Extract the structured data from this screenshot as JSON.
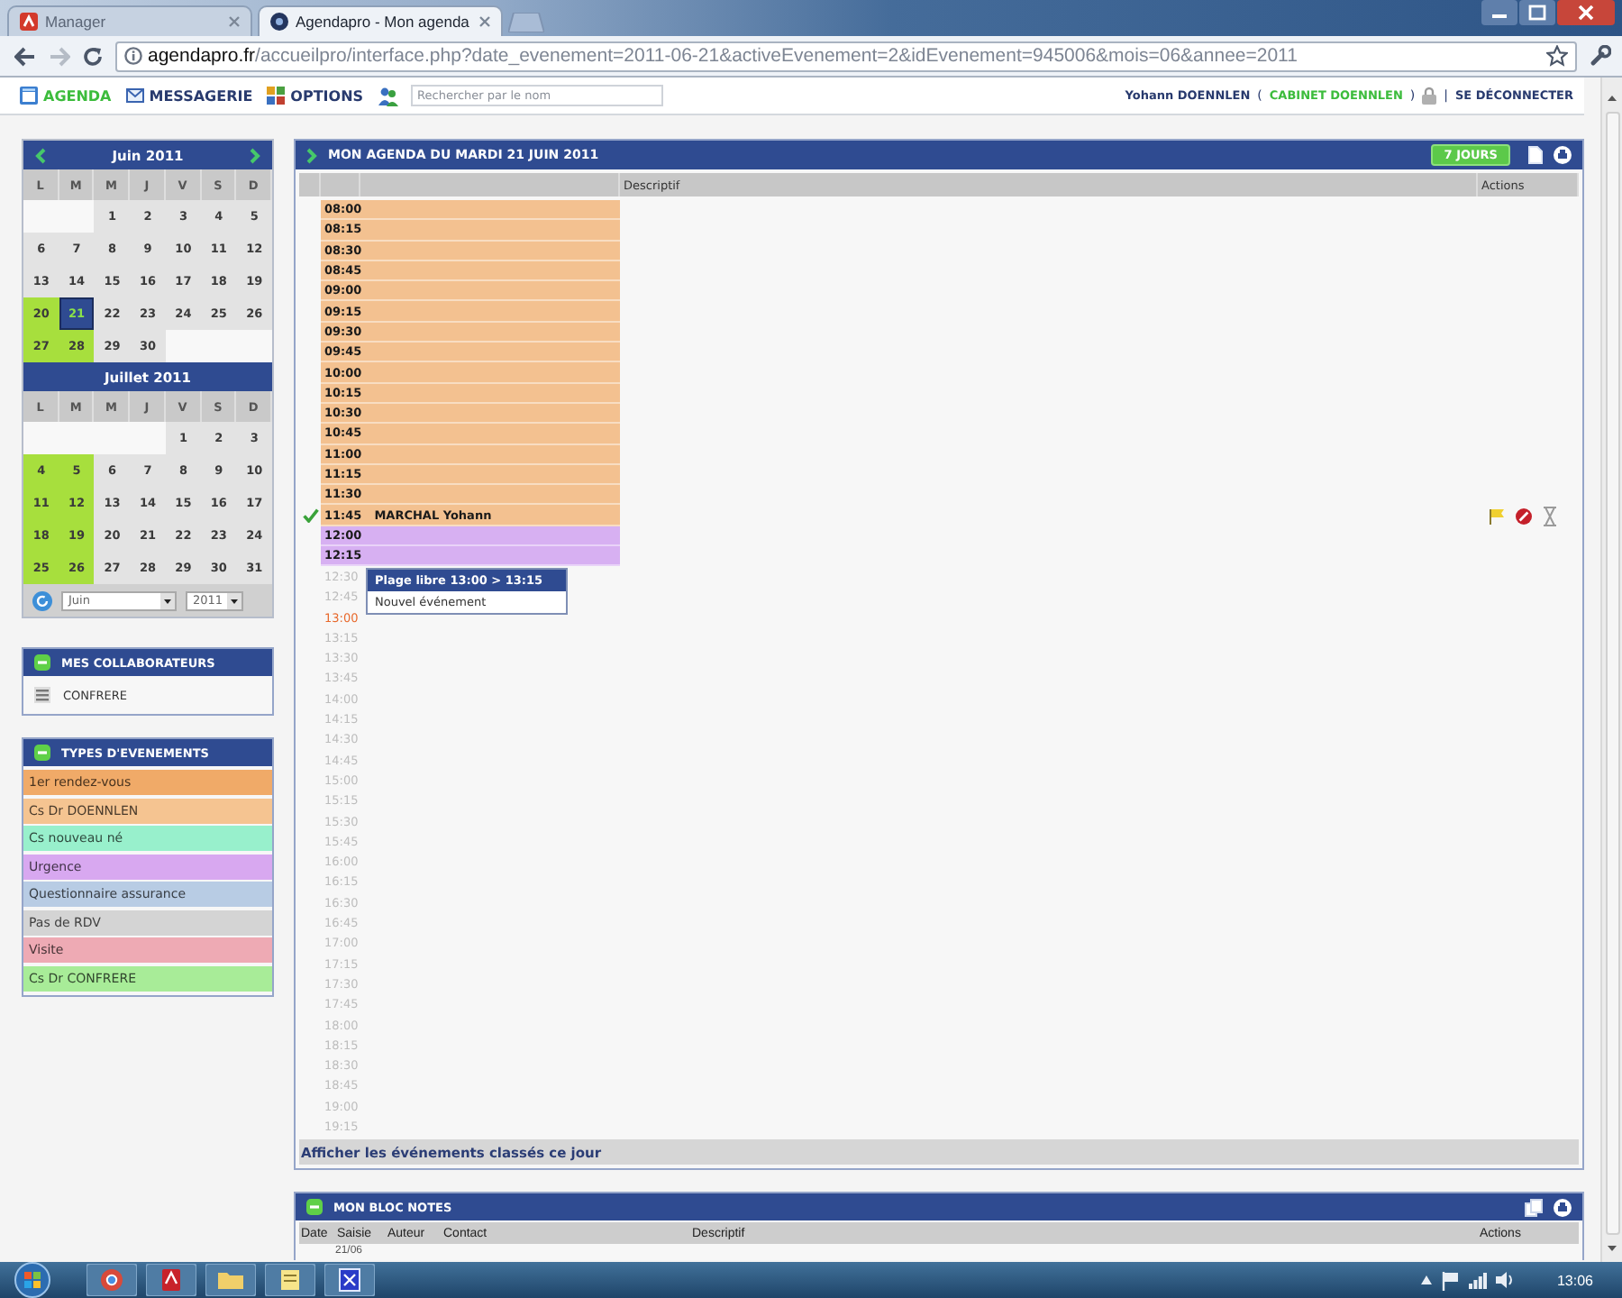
{
  "browser": {
    "tabs": [
      {
        "title": "Manager",
        "selected": false
      },
      {
        "title": "Agendapro - Mon agenda",
        "selected": true
      }
    ],
    "url_host": "agendapro.fr",
    "url_path": "/accueilpro/interface.php?date_evenement=2011-06-21&activeEvenement=2&idEvenement=945006&mois=06&annee=2011"
  },
  "nav": {
    "items": [
      {
        "label": "AGENDA",
        "selected": true
      },
      {
        "label": "MESSAGERIE",
        "selected": false
      },
      {
        "label": "OPTIONS",
        "selected": false
      }
    ],
    "search": {
      "placeholder": "Rechercher par le nom"
    },
    "user": "Yohann DOENNLEN",
    "cabinet_open": "(",
    "cabinet": "CABINET DOENNLEN",
    "cabinet_close": ")",
    "separator": "|",
    "logout": "SE DÉCONNECTER"
  },
  "calendar": {
    "months": [
      {
        "title": "Juin 2011",
        "nav_arrows": true,
        "weekdays": [
          "L",
          "M",
          "M",
          "J",
          "V",
          "S",
          "D"
        ],
        "weeks": [
          [
            {
              "d": "1",
              "has_events": false,
              "selected": false
            },
            {
              "d": "2",
              "has_events": false,
              "selected": false
            },
            {
              "d": "3",
              "has_events": false,
              "selected": false
            },
            {
              "d": "4",
              "has_events": false,
              "selected": false
            },
            {
              "d": "5",
              "has_events": false,
              "selected": false
            }
          ],
          [
            {
              "d": "6",
              "has_events": false,
              "selected": false
            },
            {
              "d": "7",
              "has_events": false,
              "selected": false
            },
            {
              "d": "8",
              "has_events": false,
              "selected": false
            },
            {
              "d": "9",
              "has_events": false,
              "selected": false
            },
            {
              "d": "10",
              "has_events": false,
              "selected": false
            },
            {
              "d": "11",
              "has_events": false,
              "selected": false
            },
            {
              "d": "12",
              "has_events": false,
              "selected": false
            }
          ],
          [
            {
              "d": "13",
              "has_events": false,
              "selected": false
            },
            {
              "d": "14",
              "has_events": false,
              "selected": false
            },
            {
              "d": "15",
              "has_events": false,
              "selected": false
            },
            {
              "d": "16",
              "has_events": false,
              "selected": false
            },
            {
              "d": "17",
              "has_events": false,
              "selected": false
            },
            {
              "d": "18",
              "has_events": false,
              "selected": false
            },
            {
              "d": "19",
              "has_events": false,
              "selected": false
            }
          ],
          [
            {
              "d": "20",
              "has_events": true,
              "selected": false
            },
            {
              "d": "21",
              "has_events": true,
              "selected": true
            },
            {
              "d": "22",
              "has_events": false,
              "selected": false
            },
            {
              "d": "23",
              "has_events": false,
              "selected": false
            },
            {
              "d": "24",
              "has_events": false,
              "selected": false
            },
            {
              "d": "25",
              "has_events": false,
              "selected": false
            },
            {
              "d": "26",
              "has_events": false,
              "selected": false
            }
          ],
          [
            {
              "d": "27",
              "has_events": true,
              "selected": false
            },
            {
              "d": "28",
              "has_events": true,
              "selected": false
            },
            {
              "d": "29",
              "has_events": false,
              "selected": false
            },
            {
              "d": "30",
              "has_events": false,
              "selected": false
            }
          ]
        ]
      },
      {
        "title": "Juillet 2011",
        "nav_arrows": false,
        "weekdays": [
          "L",
          "M",
          "M",
          "J",
          "V",
          "S",
          "D"
        ],
        "weeks": [
          [
            {
              "d": "1",
              "has_events": false,
              "selected": false
            },
            {
              "d": "2",
              "has_events": false,
              "selected": false
            },
            {
              "d": "3",
              "has_events": false,
              "selected": false
            }
          ],
          [
            {
              "d": "4",
              "has_events": true,
              "selected": false
            },
            {
              "d": "5",
              "has_events": true,
              "selected": false
            },
            {
              "d": "6",
              "has_events": false,
              "selected": false
            },
            {
              "d": "7",
              "has_events": false,
              "selected": false
            },
            {
              "d": "8",
              "has_events": false,
              "selected": false
            },
            {
              "d": "9",
              "has_events": false,
              "selected": false
            },
            {
              "d": "10",
              "has_events": false,
              "selected": false
            }
          ],
          [
            {
              "d": "11",
              "has_events": true,
              "selected": false
            },
            {
              "d": "12",
              "has_events": true,
              "selected": false
            },
            {
              "d": "13",
              "has_events": false,
              "selected": false
            },
            {
              "d": "14",
              "has_events": false,
              "selected": false
            },
            {
              "d": "15",
              "has_events": false,
              "selected": false
            },
            {
              "d": "16",
              "has_events": false,
              "selected": false
            },
            {
              "d": "17",
              "has_events": false,
              "selected": false
            }
          ],
          [
            {
              "d": "18",
              "has_events": true,
              "selected": false
            },
            {
              "d": "19",
              "has_events": true,
              "selected": false
            },
            {
              "d": "20",
              "has_events": false,
              "selected": false
            },
            {
              "d": "21",
              "has_events": false,
              "selected": false
            },
            {
              "d": "22",
              "has_events": false,
              "selected": false
            },
            {
              "d": "23",
              "has_events": false,
              "selected": false
            },
            {
              "d": "24",
              "has_events": false,
              "selected": false
            }
          ],
          [
            {
              "d": "25",
              "has_events": true,
              "selected": false
            },
            {
              "d": "26",
              "has_events": true,
              "selected": false
            },
            {
              "d": "27",
              "has_events": false,
              "selected": false
            },
            {
              "d": "28",
              "has_events": false,
              "selected": false
            },
            {
              "d": "29",
              "has_events": false,
              "selected": false
            },
            {
              "d": "30",
              "has_events": false,
              "selected": false
            },
            {
              "d": "31",
              "has_events": false,
              "selected": false
            }
          ]
        ]
      }
    ],
    "month_select": "Juin",
    "year_select": "2011"
  },
  "collaborators": {
    "title": "MES COLLABORATEURS",
    "items": [
      {
        "name": "CONFRERE"
      }
    ]
  },
  "event_types": {
    "title": "TYPES D'EVENEMENTS",
    "items": [
      {
        "label": "1er rendez-vous",
        "color": "#f0aa68"
      },
      {
        "label": "Cs Dr DOENNLEN",
        "color": "#f5c491"
      },
      {
        "label": "Cs nouveau né",
        "color": "#98f0cc"
      },
      {
        "label": "Urgence",
        "color": "#d8a8f0"
      },
      {
        "label": "Questionnaire assurance",
        "color": "#b8cce4"
      },
      {
        "label": "Pas de RDV",
        "color": "#d4d4d4"
      },
      {
        "label": "Visite",
        "color": "#eeaab4"
      },
      {
        "label": "Cs Dr CONFRERE",
        "color": "#a8ec98"
      }
    ]
  },
  "agenda": {
    "title": "MON AGENDA DU MARDI 21 JUIN 2011",
    "week_button": "7 JOURS",
    "columns": [
      "Descriptif",
      "Actions"
    ],
    "rows": [
      {
        "time": "08:00",
        "kind": "event",
        "color": "#f3c190"
      },
      {
        "time": "08:15",
        "kind": "event",
        "color": "#f3c190"
      },
      {
        "time": "08:30",
        "kind": "event",
        "color": "#f3c190"
      },
      {
        "time": "08:45",
        "kind": "event",
        "color": "#f3c190"
      },
      {
        "time": "09:00",
        "kind": "event",
        "color": "#f3c190"
      },
      {
        "time": "09:15",
        "kind": "event",
        "color": "#f3c190"
      },
      {
        "time": "09:30",
        "kind": "event",
        "color": "#f3c190"
      },
      {
        "time": "09:45",
        "kind": "event",
        "color": "#f3c190"
      },
      {
        "time": "10:00",
        "kind": "event",
        "color": "#f3c190"
      },
      {
        "time": "10:15",
        "kind": "event",
        "color": "#f3c190"
      },
      {
        "time": "10:30",
        "kind": "event",
        "color": "#f3c190"
      },
      {
        "time": "10:45",
        "kind": "event",
        "color": "#f3c190"
      },
      {
        "time": "11:00",
        "kind": "event",
        "color": "#f3c190"
      },
      {
        "time": "11:15",
        "kind": "event",
        "color": "#f3c190"
      },
      {
        "time": "11:30",
        "kind": "event",
        "color": "#f3c190"
      },
      {
        "time": "11:45",
        "kind": "appointment",
        "color": "#f3c190",
        "title": "MARCHAL Yohann",
        "confirmed": true
      },
      {
        "time": "12:00",
        "kind": "event",
        "color": "#d7b0f2"
      },
      {
        "time": "12:15",
        "kind": "event",
        "color": "#d7b0f2"
      },
      {
        "time": "12:30",
        "kind": "free"
      },
      {
        "time": "12:45",
        "kind": "free"
      },
      {
        "time": "13:00",
        "kind": "now"
      },
      {
        "time": "13:15",
        "kind": "free"
      },
      {
        "time": "13:30",
        "kind": "free"
      },
      {
        "time": "13:45",
        "kind": "free"
      },
      {
        "time": "14:00",
        "kind": "free"
      },
      {
        "time": "14:15",
        "kind": "free"
      },
      {
        "time": "14:30",
        "kind": "free"
      },
      {
        "time": "14:45",
        "kind": "free"
      },
      {
        "time": "15:00",
        "kind": "free"
      },
      {
        "time": "15:15",
        "kind": "free"
      },
      {
        "time": "15:30",
        "kind": "free"
      },
      {
        "time": "15:45",
        "kind": "free"
      },
      {
        "time": "16:00",
        "kind": "free"
      },
      {
        "time": "16:15",
        "kind": "free"
      },
      {
        "time": "16:30",
        "kind": "free"
      },
      {
        "time": "16:45",
        "kind": "free"
      },
      {
        "time": "17:00",
        "kind": "free"
      },
      {
        "time": "17:15",
        "kind": "free"
      },
      {
        "time": "17:30",
        "kind": "free"
      },
      {
        "time": "17:45",
        "kind": "free"
      },
      {
        "time": "18:00",
        "kind": "free"
      },
      {
        "time": "18:15",
        "kind": "free"
      },
      {
        "time": "18:30",
        "kind": "free"
      },
      {
        "time": "18:45",
        "kind": "free"
      },
      {
        "time": "19:00",
        "kind": "free"
      },
      {
        "time": "19:15",
        "kind": "free"
      }
    ],
    "popup": {
      "title": "Plage libre 13:00 > 13:15",
      "item": "Nouvel événement"
    },
    "footer_link": "Afficher les événements classés ce jour"
  },
  "notes": {
    "title": "MON BLOC NOTES",
    "columns": [
      "Date",
      "Saisie",
      "Auteur",
      "Contact",
      "Descriptif",
      "Actions"
    ],
    "rows": [
      {
        "saisie": "21/06"
      }
    ]
  },
  "taskbar": {
    "clock": "13:06"
  }
}
